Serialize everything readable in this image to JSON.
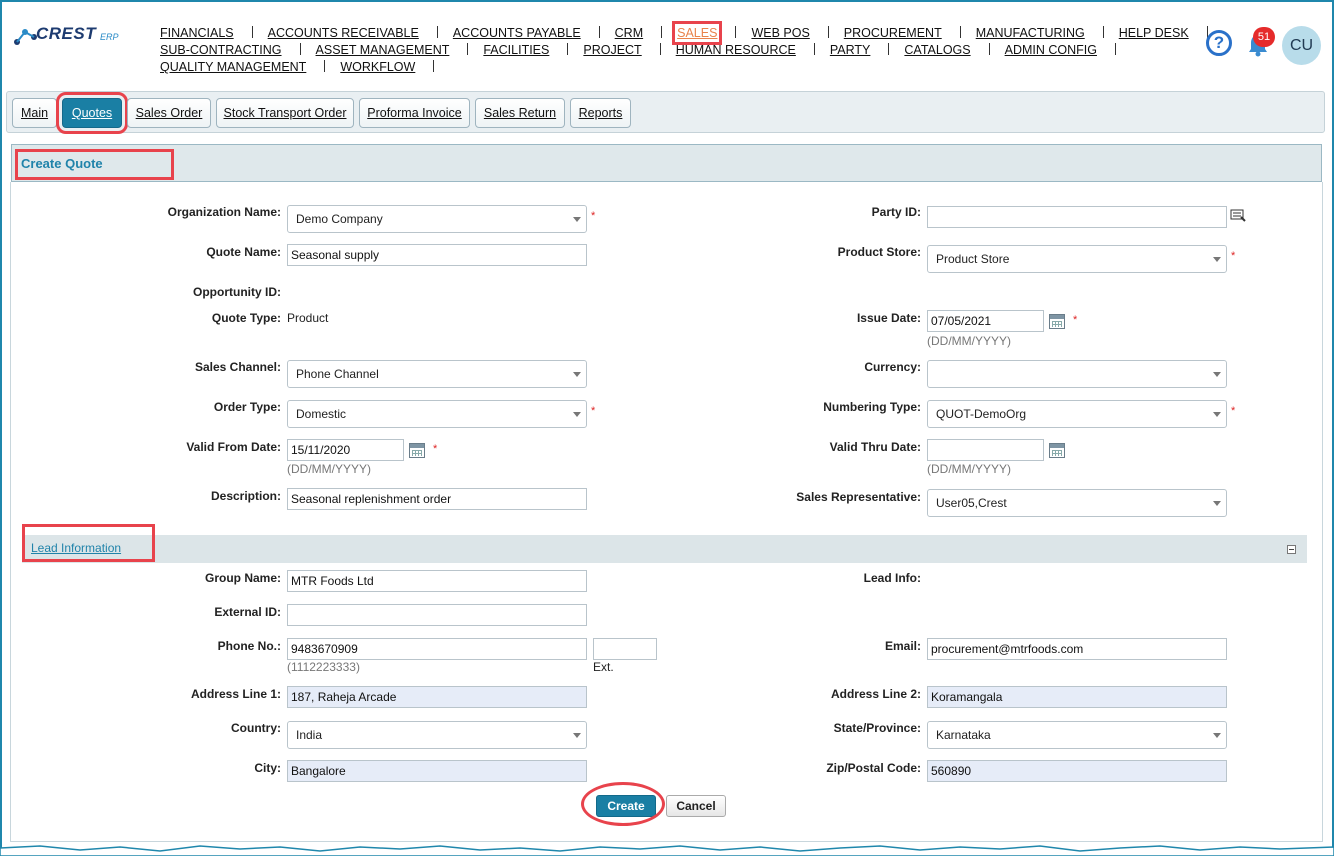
{
  "brand": {
    "name": "CREST",
    "suffix": "ERP"
  },
  "menu": {
    "row1": [
      "FINANCIALS",
      "ACCOUNTS RECEIVABLE",
      "ACCOUNTS PAYABLE",
      "CRM",
      "SALES",
      "WEB POS",
      "PROCUREMENT",
      "MANUFACTURING",
      "HELP DESK"
    ],
    "row2": [
      "SUB-CONTRACTING",
      "ASSET MANAGEMENT",
      "FACILITIES",
      "PROJECT",
      "HUMAN RESOURCE",
      "PARTY",
      "CATALOGS",
      "ADMIN CONFIG"
    ],
    "row3": [
      "QUALITY MANAGEMENT",
      "WORKFLOW"
    ],
    "active": "SALES"
  },
  "header": {
    "help_icon": "?",
    "notification_count": "51",
    "avatar_initials": "CU"
  },
  "tabs": [
    "Main",
    "Quotes",
    "Sales Order",
    "Stock Transport Order",
    "Proforma Invoice",
    "Sales Return",
    "Reports"
  ],
  "active_tab": "Quotes",
  "section_title": "Create Quote",
  "form": {
    "organization_name": {
      "label": "Organization Name:",
      "value": "Demo Company"
    },
    "quote_name": {
      "label": "Quote Name:",
      "value": "Seasonal supply"
    },
    "opportunity_id": {
      "label": "Opportunity ID:"
    },
    "quote_type": {
      "label": "Quote Type:",
      "value": "Product"
    },
    "sales_channel": {
      "label": "Sales Channel:",
      "value": "Phone Channel"
    },
    "order_type": {
      "label": "Order Type:",
      "value": "Domestic"
    },
    "valid_from_date": {
      "label": "Valid From Date:",
      "value": "15/11/2020",
      "hint": "(DD/MM/YYYY)"
    },
    "description": {
      "label": "Description:",
      "value": "Seasonal replenishment order"
    },
    "party_id": {
      "label": "Party ID:",
      "value": ""
    },
    "product_store": {
      "label": "Product Store:",
      "value": "Product Store"
    },
    "issue_date": {
      "label": "Issue Date:",
      "value": "07/05/2021",
      "hint": "(DD/MM/YYYY)"
    },
    "currency": {
      "label": "Currency:",
      "value": ""
    },
    "numbering_type": {
      "label": "Numbering Type:",
      "value": "QUOT-DemoOrg"
    },
    "valid_thru_date": {
      "label": "Valid Thru Date:",
      "value": "",
      "hint": "(DD/MM/YYYY)"
    },
    "sales_representative": {
      "label": "Sales Representative:",
      "value": "User05,Crest"
    },
    "required_mark": "*"
  },
  "lead": {
    "title": "Lead Information",
    "group_name": {
      "label": "Group Name:",
      "value": "MTR Foods Ltd"
    },
    "external_id": {
      "label": "External ID:",
      "value": ""
    },
    "phone": {
      "label": "Phone No.:",
      "value": "9483670909",
      "hint": "(1112223333)",
      "ext_label": "Ext.",
      "ext_value": ""
    },
    "address1": {
      "label": "Address Line 1:",
      "value": "187, Raheja Arcade"
    },
    "country": {
      "label": "Country:",
      "value": "India"
    },
    "city": {
      "label": "City:",
      "value": "Bangalore"
    },
    "lead_info": {
      "label": "Lead Info:"
    },
    "email": {
      "label": "Email:",
      "value": "procurement@mtrfoods.com"
    },
    "address2": {
      "label": "Address Line 2:",
      "value": "Koramangala"
    },
    "state": {
      "label": "State/Province:",
      "value": "Karnataka"
    },
    "zip": {
      "label": "Zip/Postal Code:",
      "value": "560890"
    }
  },
  "buttons": {
    "create": "Create",
    "cancel": "Cancel"
  },
  "colors": {
    "accent": "#1a7fa4",
    "highlight": "#e8434c",
    "active_menu": "#e9834c",
    "badge": "#e52b2b"
  }
}
